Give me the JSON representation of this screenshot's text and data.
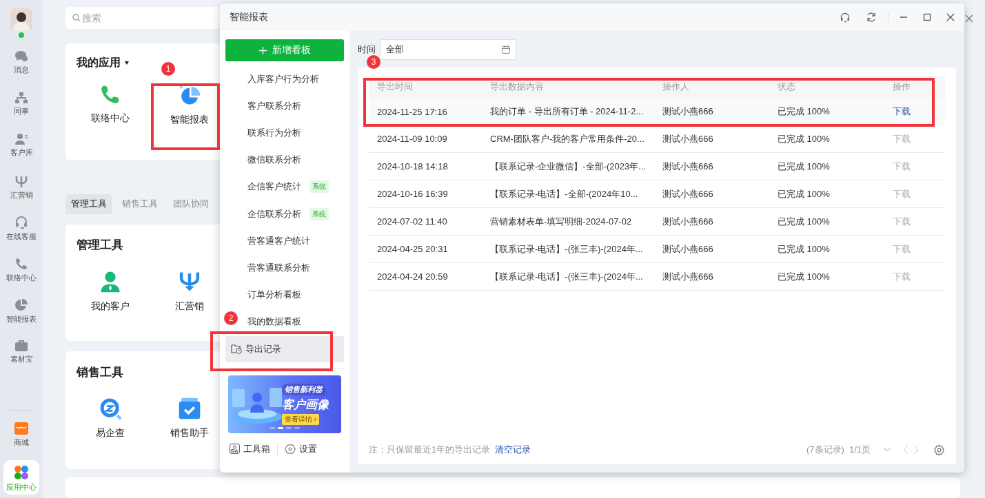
{
  "nav_rail": {
    "avatar": {
      "online": true
    },
    "items": [
      {
        "label": "消息",
        "selected": false
      },
      {
        "label": "同事",
        "selected": false
      },
      {
        "label": "客户库",
        "selected": false
      },
      {
        "label": "汇营销",
        "selected": false
      },
      {
        "label": "在线客服",
        "selected": false
      },
      {
        "label": "联络中心",
        "selected": false
      },
      {
        "label": "智能报表",
        "selected": false
      },
      {
        "label": "素材宝",
        "selected": false
      }
    ],
    "bottom_items": [
      {
        "label": "商城",
        "selected": false
      },
      {
        "label": "应用中心",
        "selected": true
      }
    ]
  },
  "search": {
    "placeholder": "搜索"
  },
  "my_apps": {
    "title": "我的应用",
    "apps": [
      {
        "label": "联络中心"
      },
      {
        "label": "智能报表"
      }
    ]
  },
  "tool_tabs": [
    {
      "label": "管理工具",
      "selected": true
    },
    {
      "label": "销售工具",
      "selected": false
    },
    {
      "label": "团队协同",
      "selected": false
    }
  ],
  "sections": [
    {
      "title": "管理工具",
      "apps": [
        {
          "label": "我的客户"
        },
        {
          "label": "汇营销"
        }
      ]
    },
    {
      "title": "销售工具",
      "apps": [
        {
          "label": "易企查"
        },
        {
          "label": "销售助手"
        }
      ]
    }
  ],
  "modal": {
    "title": "智能报表",
    "new_board_button": "新增看板",
    "menu": [
      {
        "label": "入库客户行为分析",
        "selected": false
      },
      {
        "label": "客户联系分析",
        "selected": false
      },
      {
        "label": "联系行为分析",
        "selected": false
      },
      {
        "label": "微信联系分析",
        "selected": false
      },
      {
        "label": "企信客户统计",
        "tag": "系统",
        "selected": false
      },
      {
        "label": "企信联系分析",
        "tag": "系统",
        "selected": false
      },
      {
        "label": "营客通客户统计",
        "selected": false
      },
      {
        "label": "营客通联系分析",
        "selected": false
      },
      {
        "label": "订单分析看板",
        "selected": false
      },
      {
        "label": "我的数据看板",
        "selected": false
      }
    ],
    "export_item": {
      "label": "导出记录",
      "selected": true
    },
    "banner": {
      "kicker": "销售新利器",
      "headline": "客户画像",
      "cta": "查看详情 ›",
      "slides": [
        {
          "selected": false
        },
        {
          "selected": true
        },
        {
          "selected": false
        },
        {
          "selected": false
        }
      ]
    },
    "footer_links": [
      "工具箱",
      "设置"
    ],
    "filter": {
      "label": "时间",
      "value": "全部"
    },
    "table": {
      "columns": [
        "导出时间",
        "导出数据内容",
        "操作人",
        "状态",
        "操作"
      ],
      "rows": [
        {
          "time": "2024-11-25 17:16",
          "content": "我的订单 - 导出所有订单 - 2024-11-2...",
          "operator": "测试小燕666",
          "status": "已完成 100%",
          "action": "下载",
          "selected": true
        },
        {
          "time": "2024-11-09 10:09",
          "content": "CRM-团队客户-我的客户常用条件-20...",
          "operator": "测试小燕666",
          "status": "已完成 100%",
          "action": "下载",
          "selected": false
        },
        {
          "time": "2024-10-18 14:18",
          "content": "【联系记录-企业微信】-全部-(2023年...",
          "operator": "测试小燕666",
          "status": "已完成 100%",
          "action": "下载",
          "selected": false
        },
        {
          "time": "2024-10-16 16:39",
          "content": "【联系记录-电话】-全部-(2024年10...",
          "operator": "测试小燕666",
          "status": "已完成 100%",
          "action": "下载",
          "selected": false
        },
        {
          "time": "2024-07-02 11:40",
          "content": "营销素材表单-填写明细-2024-07-02",
          "operator": "测试小燕666",
          "status": "已完成 100%",
          "action": "下载",
          "selected": false
        },
        {
          "time": "2024-04-25 20:31",
          "content": "【联系记录-电话】-(张三丰)-(2024年...",
          "operator": "测试小燕666",
          "status": "已完成 100%",
          "action": "下载",
          "selected": false
        },
        {
          "time": "2024-04-24 20:59",
          "content": "【联系记录-电话】-(张三丰)-(2024年...",
          "operator": "测试小燕666",
          "status": "已完成 100%",
          "action": "下载",
          "selected": false
        }
      ]
    },
    "note": "注：只保留最近1年的导出记录",
    "clear_link": "清空记录",
    "record_count": "(7条记录)",
    "page_info": "1/1页"
  },
  "annotations": [
    {
      "number": "1"
    },
    {
      "number": "2"
    },
    {
      "number": "3"
    }
  ]
}
